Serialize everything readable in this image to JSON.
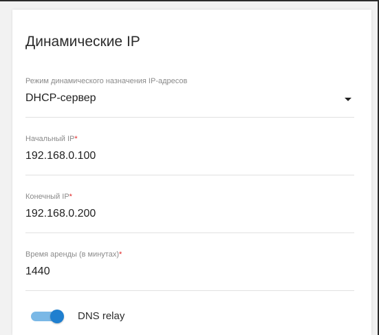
{
  "section": {
    "title": "Динамические IP"
  },
  "fields": {
    "mode": {
      "label": "Режим динамического назначения IP-адресов",
      "value": "DHCP-сервер"
    },
    "start_ip": {
      "label": "Начальный IP",
      "required": "*",
      "value": "192.168.0.100"
    },
    "end_ip": {
      "label": "Конечный IP",
      "required": "*",
      "value": "192.168.0.200"
    },
    "lease_time": {
      "label": "Время аренды (в минутах)",
      "required": "*",
      "value": "1440"
    }
  },
  "dns_relay": {
    "label": "DNS relay",
    "enabled": true
  },
  "colors": {
    "accent": "#1f7fcf",
    "accent_track": "#7ab8e6",
    "required": "#e02424",
    "label": "#8a8a8a",
    "text": "#1f1f1f"
  },
  "icons": {
    "dropdown": "chevron-down-icon"
  }
}
